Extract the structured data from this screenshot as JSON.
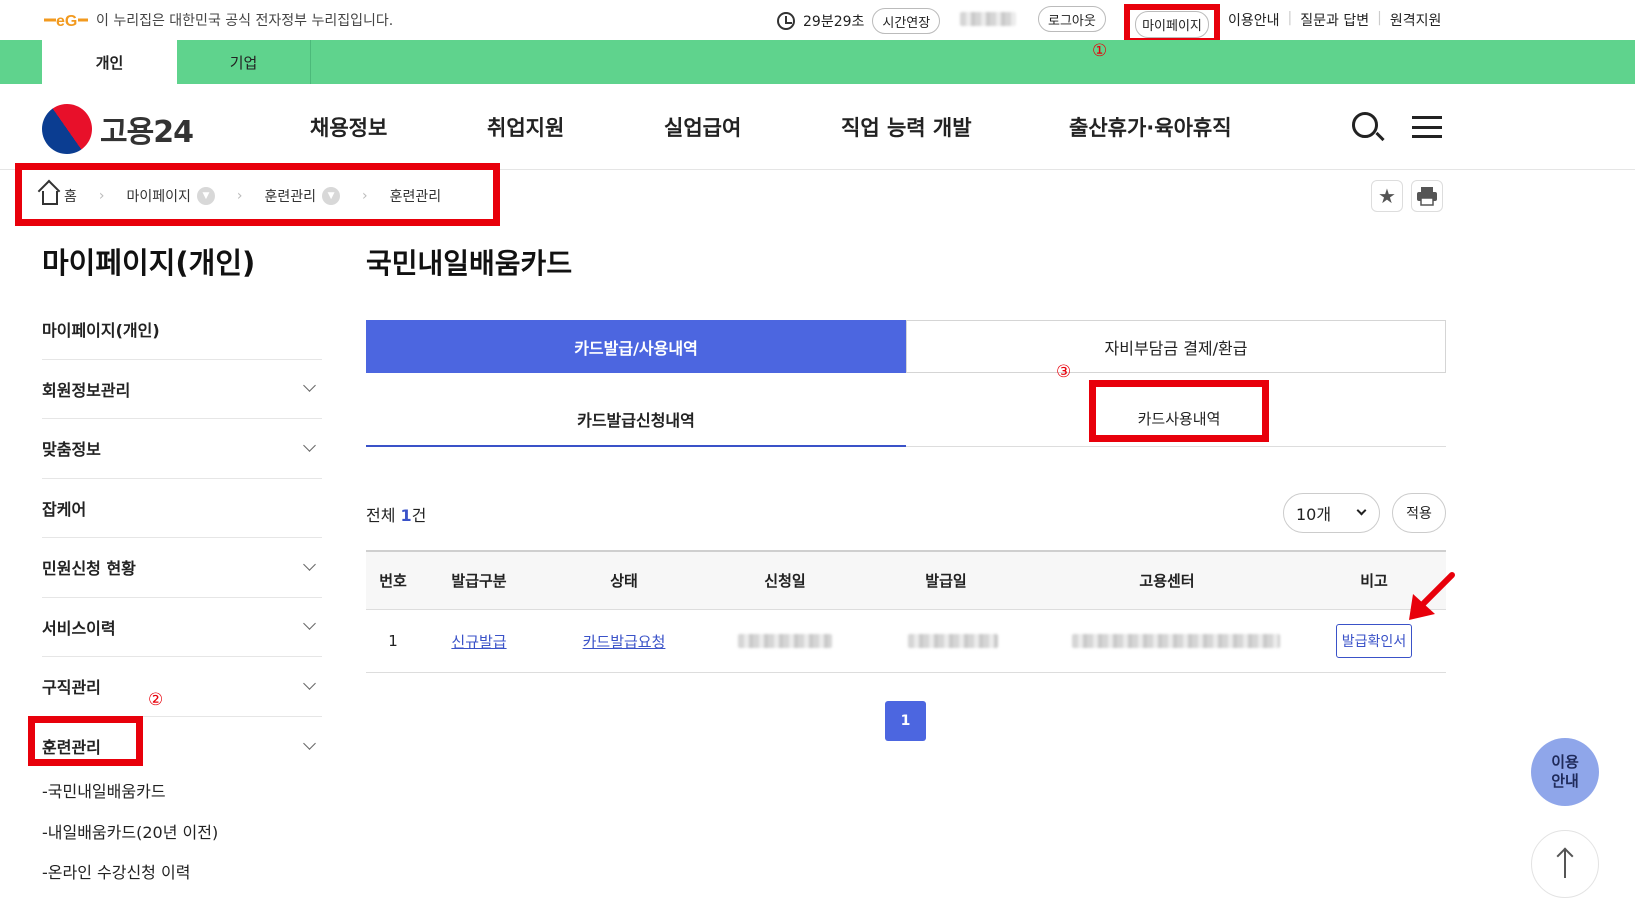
{
  "gov_bar": {
    "text": "이 누리집은 대한민국 공식 전자정부 누리집입니다.",
    "timer": "29분29초",
    "extend_label": "시간연장",
    "logout_label": "로그아웃",
    "mypage_label": "마이페이지",
    "links": [
      "이용안내",
      "질문과 답변",
      "원격지원"
    ]
  },
  "user_tabs": {
    "individual": "개인",
    "business": "기업"
  },
  "markers": {
    "one": "①",
    "two": "②",
    "three": "③"
  },
  "header": {
    "logo_text": "고용24",
    "nav": [
      "채용정보",
      "취업지원",
      "실업급여",
      "직업 능력 개발",
      "출산휴가·육아휴직"
    ]
  },
  "breadcrumb": {
    "home": "홈",
    "level1": "마이페이지",
    "level2": "훈련관리",
    "level3": "훈련관리"
  },
  "sidebar": {
    "title": "마이페이지(개인)",
    "items": [
      {
        "label": "마이페이지(개인)"
      },
      {
        "label": "회원정보관리"
      },
      {
        "label": "맞춤정보"
      },
      {
        "label": "잡케어"
      },
      {
        "label": "민원신청 현황"
      },
      {
        "label": "서비스이력"
      },
      {
        "label": "구직관리"
      },
      {
        "label": "훈련관리"
      }
    ],
    "sub_items": [
      "-국민내일배움카드",
      "-내일배움카드(20년 이전)",
      "-온라인 수강신청 이력"
    ]
  },
  "main": {
    "title": "국민내일배움카드",
    "tabs": [
      "카드발급/사용내역",
      "자비부담금 결제/환급"
    ],
    "sub_tabs": [
      "카드발급신청내역",
      "카드사용내역"
    ],
    "total_prefix": "전체 ",
    "total_count": "1",
    "total_suffix": "건",
    "page_size": "10개",
    "apply_label": "적용",
    "table": {
      "headers": [
        "번호",
        "발급구분",
        "상태",
        "신청일",
        "발급일",
        "고용센터",
        "비고"
      ],
      "rows": [
        {
          "no": "1",
          "type": "신규발급",
          "status": "카드발급요청",
          "action": "발급확인서"
        }
      ]
    },
    "page": "1"
  },
  "floating": {
    "guide_line1": "이용",
    "guide_line2": "안내"
  },
  "colors": {
    "green": "#5fd38d",
    "primary": "#4c66e0",
    "highlight": "#e8000b"
  }
}
